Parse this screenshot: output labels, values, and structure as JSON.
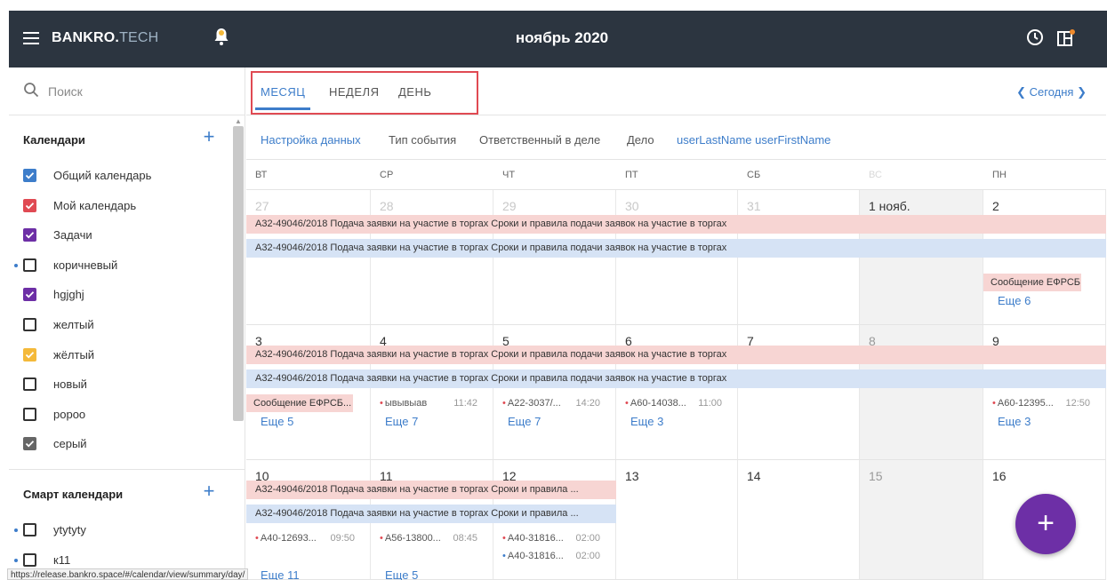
{
  "header": {
    "logo_bold": "BANKRO.",
    "logo_light": "TECH",
    "title": "ноябрь 2020"
  },
  "sidebar": {
    "search_placeholder": "Поиск",
    "calendars_title": "Календари",
    "calendars": [
      {
        "label": "Общий календарь",
        "checked": true,
        "color": "#3d7dca",
        "dot": false
      },
      {
        "label": "Мой календарь",
        "checked": true,
        "color": "#e04a53",
        "dot": false
      },
      {
        "label": "Задачи",
        "checked": true,
        "color": "#6d2fa6",
        "dot": false
      },
      {
        "label": "коричневый",
        "checked": false,
        "color": "#333333",
        "dot": true
      },
      {
        "label": "hgjghj",
        "checked": true,
        "color": "#6d2fa6",
        "dot": false
      },
      {
        "label": "желтый",
        "checked": false,
        "color": "#333333",
        "dot": false
      },
      {
        "label": "жёлтый",
        "checked": true,
        "color": "#f4b93a",
        "dot": false
      },
      {
        "label": "новый",
        "checked": false,
        "color": "#333333",
        "dot": false
      },
      {
        "label": "ророо",
        "checked": false,
        "color": "#333333",
        "dot": false
      },
      {
        "label": "серый",
        "checked": true,
        "color": "#666666",
        "dot": false
      }
    ],
    "smart_title": "Смарт календари",
    "smart": [
      {
        "label": "ytytyty",
        "checked": false,
        "dot": true
      },
      {
        "label": "к11",
        "checked": false,
        "dot": true
      }
    ],
    "status_url": "https://release.bankro.space/#/calendar/view/summary/day/"
  },
  "tabs": [
    {
      "label": "МЕСЯЦ",
      "active": true
    },
    {
      "label": "НЕДЕЛЯ",
      "active": false
    },
    {
      "label": "ДЕНЬ",
      "active": false
    }
  ],
  "nav": {
    "today": "Сегодня"
  },
  "filters": [
    {
      "label": "Настройка данных",
      "accent": true
    },
    {
      "label": "Тип события",
      "accent": false
    },
    {
      "label": "Ответственный в деле",
      "accent": false
    },
    {
      "label": "Дело",
      "accent": false
    },
    {
      "label": "userLastName userFirstName",
      "accent": true
    }
  ],
  "days": [
    "ВТ",
    "СР",
    "ЧТ",
    "ПТ",
    "СБ",
    "ВС",
    "ПН"
  ],
  "weeks": [
    {
      "dates": [
        "27",
        "28",
        "29",
        "30",
        "31",
        "1 нояб.",
        "2"
      ],
      "bands": [
        {
          "text": "А32-49046/2018 Подача заявки на участие в торгах Сроки и правила подачи заявок на участие в торгах",
          "color": "pink",
          "span": 7
        },
        {
          "text": "А32-49046/2018 Подача заявки на участие в торгах Сроки и правила подачи заявок на участие в торгах",
          "color": "blue",
          "span": 7
        }
      ],
      "events": [
        [],
        [],
        [],
        [],
        [],
        [],
        [
          {
            "chip": "Сообщение ЕФРСБ..."
          }
        ]
      ],
      "more": [
        "",
        "",
        "",
        "",
        "",
        "",
        "Еще 6"
      ]
    },
    {
      "dates": [
        "3",
        "4",
        "5",
        "6",
        "7",
        "8",
        "9"
      ],
      "bands": [
        {
          "text": "А32-49046/2018 Подача заявки на участие в торгах Сроки и правила подачи заявок на участие в торгах",
          "color": "pink",
          "span": 7
        },
        {
          "text": "А32-49046/2018 Подача заявки на участие в торгах Сроки и правила подачи заявок на участие в торгах",
          "color": "blue",
          "span": 7
        }
      ],
      "events": [
        [
          {
            "chip": "Сообщение ЕФРСБ..."
          }
        ],
        [
          {
            "text": "ывывыав",
            "time": "11:42"
          }
        ],
        [
          {
            "text": "А22-3037/...",
            "time": "14:20"
          }
        ],
        [
          {
            "text": "А60-14038...",
            "time": "11:00"
          }
        ],
        [],
        [],
        [
          {
            "text": "А60-12395...",
            "time": "12:50"
          }
        ]
      ],
      "more": [
        "Еще 5",
        "Еще 7",
        "Еще 7",
        "Еще 3",
        "",
        "",
        "Еще 3"
      ]
    },
    {
      "dates": [
        "10",
        "11",
        "12",
        "13",
        "14",
        "15",
        "16"
      ],
      "bands": [
        {
          "text": "А32-49046/2018 Подача заявки на участие в торгах Сроки и правила ...",
          "color": "pink",
          "span": 3
        },
        {
          "text": "А32-49046/2018 Подача заявки на участие в торгах Сроки и правила ...",
          "color": "blue",
          "span": 3
        }
      ],
      "events": [
        [
          {
            "text": "А40-12693...",
            "time": "09:50"
          }
        ],
        [
          {
            "text": "А56-13800...",
            "time": "08:45"
          }
        ],
        [
          {
            "text": "А40-31816...",
            "time": "02:00"
          },
          {
            "text": "А40-31816...",
            "time": "02:00",
            "blue": true
          }
        ],
        [],
        [],
        [],
        []
      ],
      "more": [
        "Еще 11",
        "Еще 5",
        "",
        "",
        "",
        "",
        ""
      ]
    }
  ]
}
